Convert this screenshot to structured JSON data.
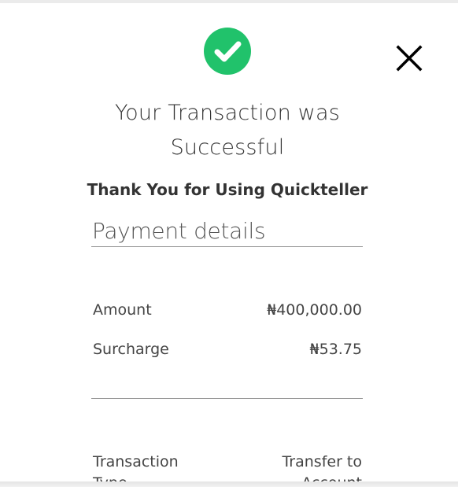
{
  "modal": {
    "icons": {
      "success": "check-circle-icon",
      "close": "close-icon"
    },
    "title": "Your Transaction was Successful",
    "subtitle": "Thank You for Using Quickteller",
    "section_title": "Payment details",
    "rows": [
      {
        "label": "Amount",
        "value": "₦400,000.00"
      },
      {
        "label": "Surcharge",
        "value": "₦53.75"
      },
      {
        "label": "Transaction Type",
        "value": "Transfer to Account"
      }
    ]
  },
  "colors": {
    "success_green": "#21c26b",
    "text": "#333333",
    "divider": "#999999"
  }
}
